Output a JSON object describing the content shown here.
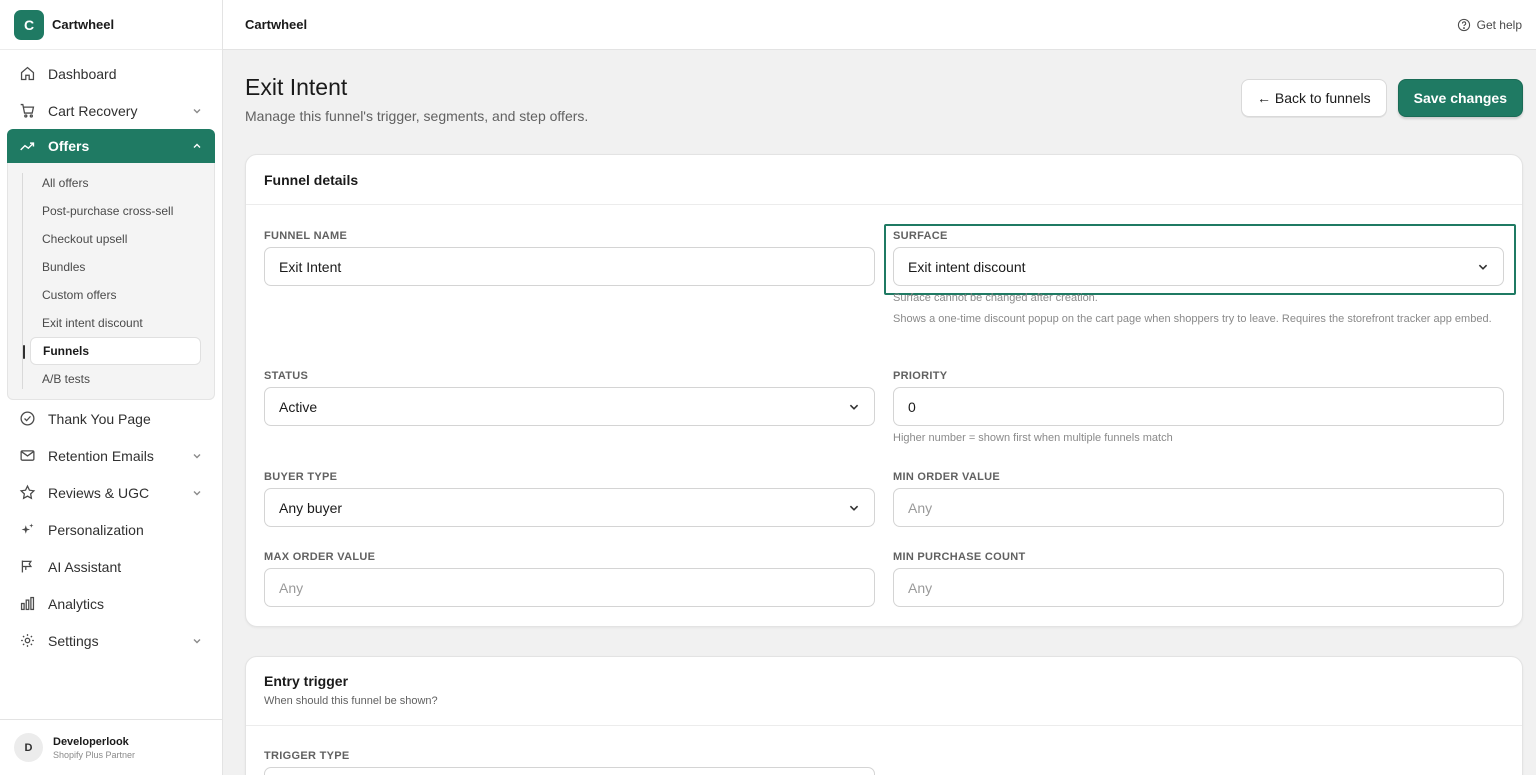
{
  "app": {
    "initial": "C",
    "name": "Cartwheel"
  },
  "topbar": {
    "title": "Cartwheel",
    "help": "Get help"
  },
  "nav": {
    "dashboard": "Dashboard",
    "cart_recovery": "Cart Recovery",
    "offers": "Offers",
    "offers_sub": [
      "All offers",
      "Post-purchase cross-sell",
      "Checkout upsell",
      "Bundles",
      "Custom offers",
      "Exit intent discount",
      "Funnels",
      "A/B tests"
    ],
    "thank_you": "Thank You Page",
    "retention": "Retention Emails",
    "reviews": "Reviews & UGC",
    "personalization": "Personalization",
    "ai_assistant": "AI Assistant",
    "analytics": "Analytics",
    "settings": "Settings"
  },
  "account": {
    "initial": "D",
    "name": "Developerlook",
    "role": "Shopify Plus Partner"
  },
  "page": {
    "title": "Exit Intent",
    "subtitle": "Manage this funnel's trigger, segments, and step offers.",
    "back": "← Back to funnels",
    "save": "Save changes"
  },
  "funnel_details": {
    "title": "Funnel details",
    "name_label": "FUNNEL NAME",
    "name_value": "Exit Intent",
    "surface_label": "SURFACE",
    "surface_value": "Exit intent discount",
    "surface_hint1": "Surface cannot be changed after creation.",
    "surface_hint2": "Shows a one-time discount popup on the cart page when shoppers try to leave. Requires the storefront tracker app embed.",
    "status_label": "STATUS",
    "status_value": "Active",
    "priority_label": "PRIORITY",
    "priority_value": "0",
    "priority_hint": "Higher number = shown first when multiple funnels match",
    "buyer_label": "BUYER TYPE",
    "buyer_value": "Any buyer",
    "min_order_label": "MIN ORDER VALUE",
    "min_order_placeholder": "Any",
    "max_order_label": "MAX ORDER VALUE",
    "max_order_placeholder": "Any",
    "min_purchase_label": "MIN PURCHASE COUNT",
    "min_purchase_placeholder": "Any"
  },
  "entry_trigger": {
    "title": "Entry trigger",
    "subtitle": "When should this funnel be shown?",
    "trigger_label": "TRIGGER TYPE"
  },
  "colors": {
    "accent": "#1f7a63",
    "background": "#f1f1f1"
  }
}
